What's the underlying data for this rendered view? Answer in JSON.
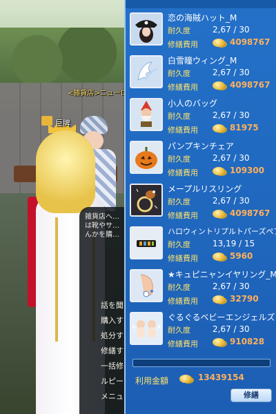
{
  "scene": {
    "npc_tag": "<雑貨店>ニューロ",
    "player_name": "巨牌"
  },
  "shop_dialog": {
    "message": "雑貨店へ… は靴やサ… んかを購…",
    "menu": [
      "話を聞",
      "購入す",
      "処分す",
      "修繕す",
      "一括修",
      "ルピー",
      "メニュー"
    ]
  },
  "repair_panel": {
    "items": [
      {
        "name": "恋の海賊ハット_M",
        "durability_label": "耐久度",
        "durability": "2,67",
        "durability_max": "30",
        "cost_label": "修繕費用",
        "cost": "4098767",
        "icon": "pirate-hat-icon"
      },
      {
        "name": "白雪瞳ウィング_M",
        "durability_label": "耐久度",
        "durability": "2,67",
        "durability_max": "30",
        "cost_label": "修繕費用",
        "cost": "4098767",
        "icon": "wing-icon"
      },
      {
        "name": "小人のバッグ",
        "durability_label": "耐久度",
        "durability": "2,67",
        "durability_max": "30",
        "cost_label": "修繕費用",
        "cost": "81975",
        "icon": "dwarf-bag-icon"
      },
      {
        "name": "パンプキンチェア",
        "durability_label": "耐久度",
        "durability": "2,67",
        "durability_max": "30",
        "cost_label": "修繕費用",
        "cost": "109300",
        "icon": "pumpkin-chair-icon"
      },
      {
        "name": "メープルリスリング",
        "durability_label": "耐久度",
        "durability": "2,67",
        "durability_max": "30",
        "cost_label": "修繕費用",
        "cost": "4098767",
        "icon": "squirrel-ring-icon"
      },
      {
        "name": "ハロウィントリプルトパーズペアリング",
        "durability_label": "耐久度",
        "durability": "13,19",
        "durability_max": "15",
        "cost_label": "修繕費用",
        "cost": "5960",
        "icon": "topaz-ring-icon"
      },
      {
        "name": "★キュピニャンイヤリング_M",
        "durability_label": "耐久度",
        "durability": "2,67",
        "durability_max": "30",
        "cost_label": "修繕費用",
        "cost": "32790",
        "icon": "earring-icon"
      },
      {
        "name": "ぐるぐるベビーエンジェルズ",
        "durability_label": "耐久度",
        "durability": "2,67",
        "durability_max": "30",
        "cost_label": "修繕費用",
        "cost": "910828",
        "icon": "baby-angels-icon"
      }
    ],
    "total_label": "利用金額",
    "total_value": "13439154",
    "repair_button": "修繕"
  }
}
